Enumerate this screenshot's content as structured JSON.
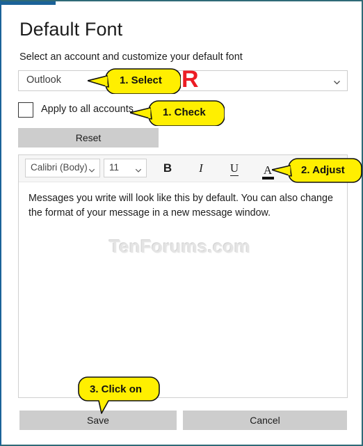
{
  "window": {
    "accent_color": "#1b6298",
    "border_color": "#2f6a77"
  },
  "header": {
    "title": "Default Font",
    "subtitle": "Select an account and customize your default font"
  },
  "account_select": {
    "value": "Outlook",
    "chevron_icon": "chevron-down-icon"
  },
  "apply_all": {
    "label": "Apply to all accounts",
    "checked": false
  },
  "reset_button": {
    "label": "Reset"
  },
  "editor": {
    "toolbar": {
      "font_name": "Calibri (Body)",
      "font_size": "11",
      "bold_label": "B",
      "italic_label": "I",
      "underline_label": "U",
      "font_color_label": "A",
      "font_color_swatch": "#111111"
    },
    "preview_text": "Messages you write will look like this by default. You can also change the format of your message in a new message window."
  },
  "watermark": {
    "text": "TenForums.com",
    "color": "#e4e4e4"
  },
  "footer": {
    "save_label": "Save",
    "cancel_label": "Cancel"
  },
  "annotations": {
    "or_label": "OR",
    "or_color": "#ec1c24",
    "callout_color": "#ffef00",
    "step_select": "1. Select",
    "step_check": "1. Check",
    "step_adjust": "2. Adjust",
    "step_click": "3. Click on"
  }
}
